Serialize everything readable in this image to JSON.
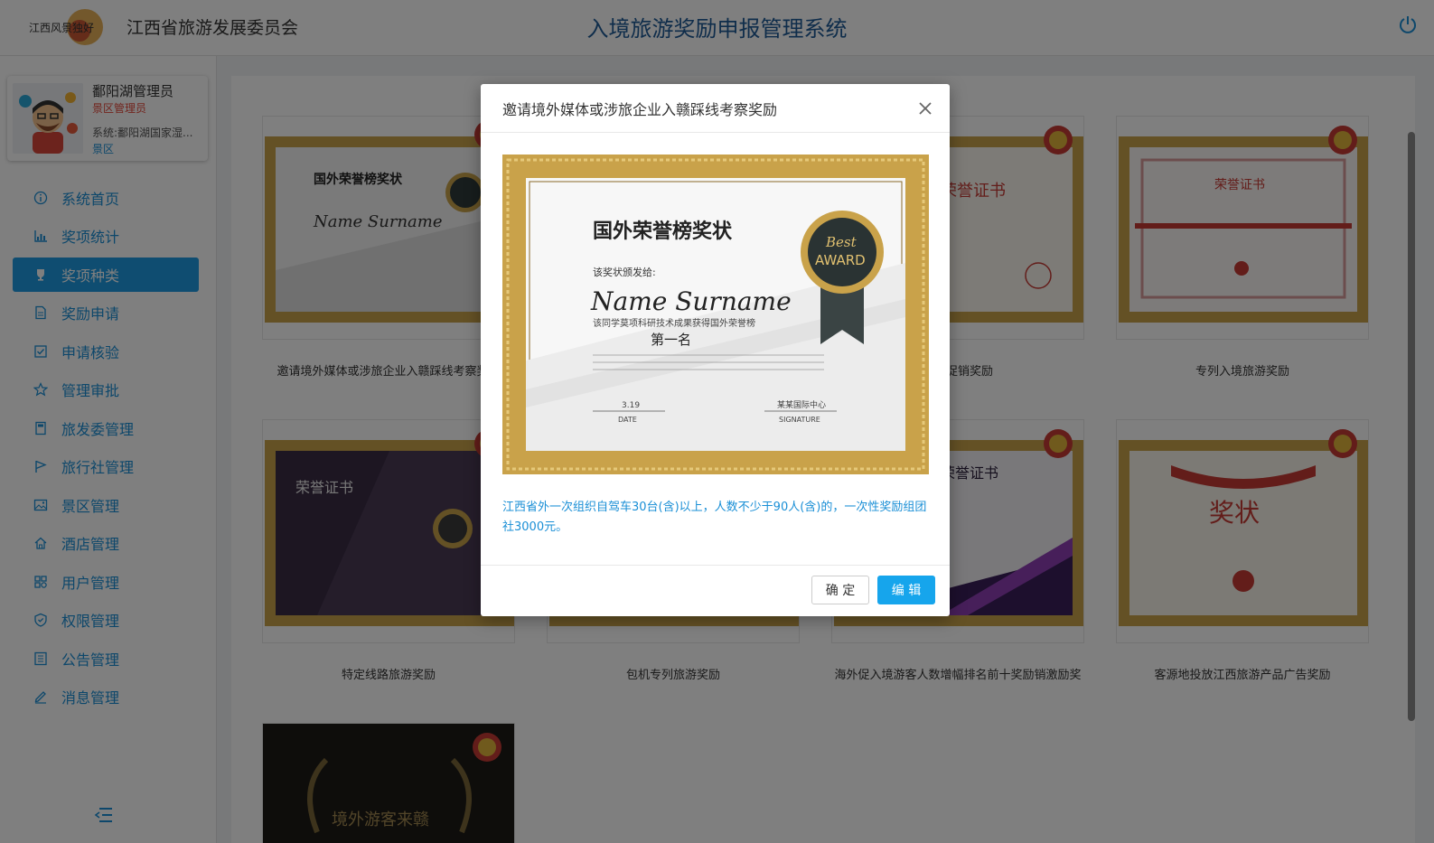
{
  "header": {
    "org_name": "江西省旅游发展委员会",
    "system_title": "入境旅游奖励申报管理系统",
    "logo_text": "江西风景独好"
  },
  "user": {
    "name": "鄱阳湖管理员",
    "role": "景区管理员",
    "system": "系统:鄱阳湖国家湿...",
    "type": "景区"
  },
  "nav": [
    {
      "label": "系统首页",
      "icon": "info-circle-icon",
      "active": false
    },
    {
      "label": "奖项统计",
      "icon": "chart-icon",
      "active": false
    },
    {
      "label": "奖项种类",
      "icon": "trophy-icon",
      "active": true
    },
    {
      "label": "奖励申请",
      "icon": "document-icon",
      "active": false
    },
    {
      "label": "申请核验",
      "icon": "checkbox-icon",
      "active": false
    },
    {
      "label": "管理审批",
      "icon": "star-icon",
      "active": false
    },
    {
      "label": "旅发委管理",
      "icon": "book-icon",
      "active": false
    },
    {
      "label": "旅行社管理",
      "icon": "flag-icon",
      "active": false
    },
    {
      "label": "景区管理",
      "icon": "image-icon",
      "active": false
    },
    {
      "label": "酒店管理",
      "icon": "home-icon",
      "active": false
    },
    {
      "label": "用户管理",
      "icon": "users-icon",
      "active": false
    },
    {
      "label": "权限管理",
      "icon": "shield-icon",
      "active": false
    },
    {
      "label": "公告管理",
      "icon": "list-icon",
      "active": false
    },
    {
      "label": "消息管理",
      "icon": "pen-icon",
      "active": false
    }
  ],
  "cards": [
    {
      "title": "邀请境外媒体或涉旅企业入赣踩线考察奖励",
      "certificate": "国外荣誉榜奖状"
    },
    {
      "title": "",
      "certificate": ""
    },
    {
      "title": "旅游促销奖励",
      "certificate": "荣誉证书"
    },
    {
      "title": "专列入境旅游奖励",
      "certificate": "荣誉证书"
    },
    {
      "title": "特定线路旅游奖励",
      "certificate": "荣誉证书"
    },
    {
      "title": "包机专列旅游奖励",
      "certificate": ""
    },
    {
      "title": "海外促入境游客人数增幅排名前十奖励销激励奖",
      "certificate": "荣誉证书"
    },
    {
      "title": "客源地投放江西旅游产品广告奖励",
      "certificate": "奖状"
    },
    {
      "title": "",
      "certificate": "境外游客来赣"
    }
  ],
  "modal": {
    "title": "邀请境外媒体或涉旅企业入赣踩线考察奖励",
    "description": "江西省外一次组织自驾车30台(含)以上，人数不少于90人(含)的，一次性奖励组团社3000元。",
    "ok_label": "确 定",
    "edit_label": "编 辑",
    "certificate": {
      "heading": "国外荣誉榜奖状",
      "recipient_label": "该奖状颁发给:",
      "name": "Name Surname",
      "line": "该同学莫项科研技术成果获得国外荣誉榜",
      "rank": "第一名",
      "badge_top": "Best",
      "badge_bottom": "AWARD",
      "date_value": "3.19",
      "date_label": "DATE",
      "sign_value": "某某国际中心",
      "sign_label": "SIGNATURE"
    }
  },
  "colors": {
    "primary": "#1e9be3",
    "title_blue": "#1f5a96",
    "role_red": "#e5483b",
    "gold": "#c9a24a"
  }
}
